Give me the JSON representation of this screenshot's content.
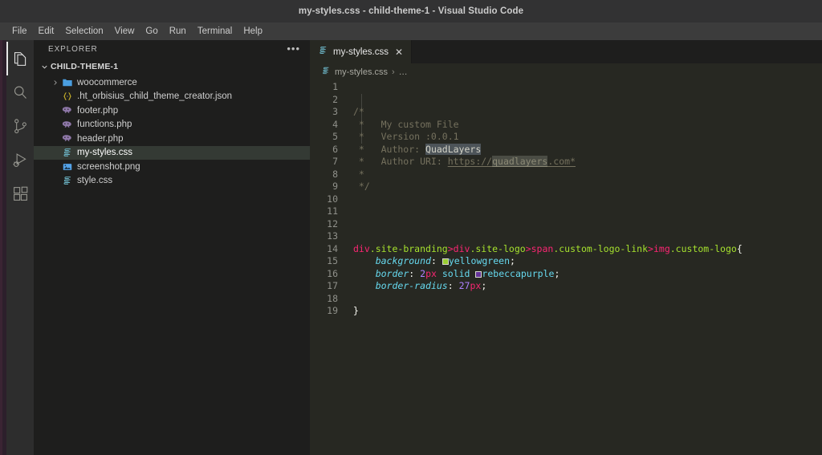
{
  "window": {
    "title": "my-styles.css - child-theme-1 - Visual Studio Code"
  },
  "menubar": {
    "items": [
      {
        "label": "File"
      },
      {
        "label": "Edit"
      },
      {
        "label": "Selection"
      },
      {
        "label": "View"
      },
      {
        "label": "Go"
      },
      {
        "label": "Run"
      },
      {
        "label": "Terminal"
      },
      {
        "label": "Help"
      }
    ]
  },
  "activitybar": {
    "items": [
      {
        "name": "explorer",
        "icon": "files-icon",
        "active": true
      },
      {
        "name": "search",
        "icon": "search-icon",
        "active": false
      },
      {
        "name": "source-control",
        "icon": "source-control-icon",
        "active": false
      },
      {
        "name": "run-and-debug",
        "icon": "run-debug-icon",
        "active": false
      },
      {
        "name": "extensions",
        "icon": "extensions-icon",
        "active": false
      }
    ]
  },
  "sidebar": {
    "header_title": "EXPLORER",
    "more_actions": "•••",
    "root_folder": "CHILD-THEME-1",
    "files": [
      {
        "label": "woocommerce",
        "icon": "folder-icon",
        "type": "folder",
        "expandable": true,
        "expanded": false,
        "depth": 1,
        "selected": false
      },
      {
        "label": ".ht_orbisius_child_theme_creator.json",
        "icon": "json-icon",
        "type": "file",
        "expandable": false,
        "depth": 1,
        "selected": false
      },
      {
        "label": "footer.php",
        "icon": "php-icon",
        "type": "file",
        "expandable": false,
        "depth": 1,
        "selected": false
      },
      {
        "label": "functions.php",
        "icon": "php-icon",
        "type": "file",
        "expandable": false,
        "depth": 1,
        "selected": false
      },
      {
        "label": "header.php",
        "icon": "php-icon",
        "type": "file",
        "expandable": false,
        "depth": 1,
        "selected": false
      },
      {
        "label": "my-styles.css",
        "icon": "css-icon",
        "type": "file",
        "expandable": false,
        "depth": 1,
        "selected": true
      },
      {
        "label": "screenshot.png",
        "icon": "image-icon",
        "type": "file",
        "expandable": false,
        "depth": 1,
        "selected": false
      },
      {
        "label": "style.css",
        "icon": "css-icon",
        "type": "file",
        "expandable": false,
        "depth": 1,
        "selected": false
      }
    ]
  },
  "editor": {
    "tab": {
      "label": "my-styles.css",
      "icon": "css-icon",
      "close_label": "✕",
      "active": true
    },
    "breadcrumb": {
      "icon": "css-icon",
      "file": "my-styles.css",
      "separator": "›",
      "symbol": "…"
    },
    "language": "css",
    "line_numbers": [
      "1",
      "2",
      "3",
      "4",
      "5",
      "6",
      "7",
      "8",
      "9",
      "10",
      "11",
      "12",
      "13",
      "14",
      "15",
      "16",
      "17",
      "18",
      "19"
    ],
    "code_lines": [
      {
        "n": "1",
        "text": ""
      },
      {
        "n": "2",
        "text": ""
      },
      {
        "n": "3",
        "text": "/*"
      },
      {
        "n": "4",
        "text": " *   My custom File"
      },
      {
        "n": "5",
        "text": " *   Version :0.0.1"
      },
      {
        "n": "6",
        "text": " *   Author: QuadLayers"
      },
      {
        "n": "7",
        "text": " *   Author URI: https://quadlayers.com*"
      },
      {
        "n": "8",
        "text": " *"
      },
      {
        "n": "9",
        "text": " */"
      },
      {
        "n": "10",
        "text": ""
      },
      {
        "n": "11",
        "text": ""
      },
      {
        "n": "12",
        "text": ""
      },
      {
        "n": "13",
        "text": ""
      },
      {
        "n": "14",
        "text": "div.site-branding>div.site-logo>span.custom-logo-link>img.custom-logo{"
      },
      {
        "n": "15",
        "text": "    background: yellowgreen;"
      },
      {
        "n": "16",
        "text": "    border: 2px solid rebeccapurple;"
      },
      {
        "n": "17",
        "text": "    border-radius: 27px;"
      },
      {
        "n": "18",
        "text": ""
      },
      {
        "n": "19",
        "text": "}"
      }
    ],
    "tokens": {
      "comment_open": "/*",
      "comment_star": " *",
      "comment_line4": " *   My custom File",
      "comment_line5": " *   Version :0.0.1",
      "comment_line6_prefix": " *   Author: ",
      "comment_line6_selected": "QuadLayers",
      "comment_line7_prefix": " *   Author URI: ",
      "comment_line7_url_a": "https://",
      "comment_line7_url_match": "quadlayers",
      "comment_line7_url_b": ".com*",
      "comment_close": " */",
      "sel_div1": "div",
      "sel_cls1": ".site-branding",
      "sel_gt1": ">",
      "sel_div2": "div",
      "sel_cls2": ".site-logo",
      "sel_gt2": ">",
      "sel_span": "span",
      "sel_cls3": ".custom-logo-link",
      "sel_gt3": ">",
      "sel_img": "img",
      "sel_cls4": ".custom-logo",
      "open_brace": "{",
      "close_brace": "}",
      "prop_background": "background",
      "prop_border": "border",
      "prop_border_radius": "border-radius",
      "colon": ":",
      "semicolon": ";",
      "val_yellowgreen": "yellowgreen",
      "val_rebeccapurple": "rebeccapurple",
      "val_2": "2",
      "val_px": "px",
      "val_solid": "solid",
      "val_27": "27",
      "indent": "    "
    },
    "color_swatches": [
      {
        "name": "yellowgreen",
        "hex": "#9acd32"
      },
      {
        "name": "rebeccapurple",
        "hex": "#663399"
      }
    ]
  },
  "theme": {
    "titlebar_bg": "#323233",
    "menubar_bg": "#3c3c3c",
    "activitybar_bg": "#2d2d2d",
    "sidebar_bg": "#1e1e1d",
    "editor_bg": "#272822",
    "edge_strip": "#2c1f2b",
    "selected_row_bg": "#343a34",
    "token_tag": "#f92672",
    "token_class": "#a6e22e",
    "token_property": "#66d9ef",
    "token_number": "#ae81ff",
    "token_comment": "#75715e",
    "foreground": "#f8f8f2"
  }
}
